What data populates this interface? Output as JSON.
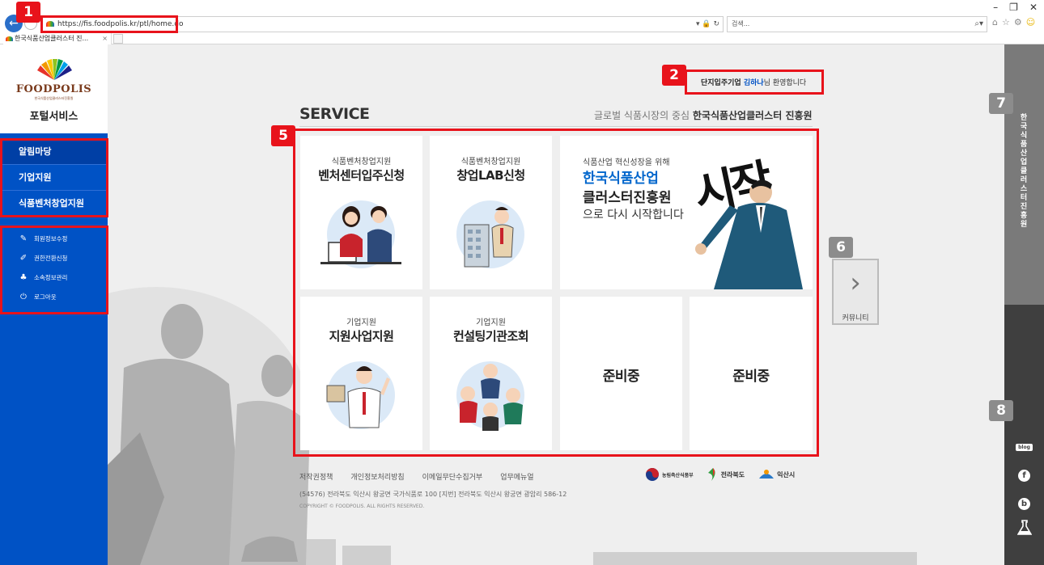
{
  "browser": {
    "url": "https://fis.foodpolis.kr/ptl/home.do",
    "search_placeholder": "검색...",
    "tab_title": "한국식품산업클러스터 진...",
    "addr_tools": "▾ 🔒 ↻"
  },
  "sidebar": {
    "logo": "FOODPOLIS",
    "logo_sub": "한국식품산업클러스터진흥원",
    "portal_title": "포털서비스",
    "menu": [
      "알림마당",
      "기업지원",
      "식품벤처창업지원"
    ],
    "util": [
      {
        "label": "회원정보수정",
        "icon": "edit-icon"
      },
      {
        "label": "권한전환신청",
        "icon": "pencil-icon"
      },
      {
        "label": "소속정보관리",
        "icon": "org-icon"
      },
      {
        "label": "로그아웃",
        "icon": "power-icon"
      }
    ]
  },
  "welcome": {
    "prefix": "단지입주기업 ",
    "name": "김하나",
    "suffix": "님 환영합니다"
  },
  "service": {
    "title": "SERVICE",
    "tagline_pre": "글로벌 식품시장의 중심 ",
    "tagline_bold": "한국식품산업클러스터 진흥원"
  },
  "cards": [
    {
      "category": "식품벤처창업지원",
      "title": "벤처센터입주신청"
    },
    {
      "category": "식품벤처창업지원",
      "title": "창업LAB신청"
    },
    {
      "category": "기업지원",
      "title": "지원사업지원"
    },
    {
      "category": "기업지원",
      "title": "컨설팅기관조회"
    },
    {
      "title": "준비중"
    },
    {
      "title": "준비중"
    }
  ],
  "promo": {
    "line1": "식품산업 혁신성장을 위해",
    "line2": "한국식품산업",
    "line3": "클러스터진흥원",
    "line4": "으로 다시 시작합니다",
    "calligraphy": "시작"
  },
  "community": {
    "label": "커뮤니티"
  },
  "footer": {
    "links": [
      "저작권정책",
      "개인정보처리방침",
      "이메일무단수집거부",
      "업무메뉴얼"
    ],
    "address": "(54576) 전라북도 익산시 왕궁면 국가식품로 100  [지번] 전라북도 익산시 왕궁면 광암리 586-12",
    "copyright": "COPYRIGHT © FOODPOLIS. ALL RIGHTS RESERVED.",
    "logos": [
      "농림축산식품부",
      "전라북도",
      "익산시"
    ]
  },
  "right_panel": {
    "vertical_text": "한국식품산업클러스터진흥원",
    "social": [
      "blog",
      "f",
      "b"
    ]
  },
  "annotations": [
    "1",
    "2",
    "5",
    "6",
    "7",
    "8"
  ],
  "colors": {
    "sidebar": "#0052c5",
    "highlight": "#e8131b",
    "promo_accent": "#0066cc"
  }
}
